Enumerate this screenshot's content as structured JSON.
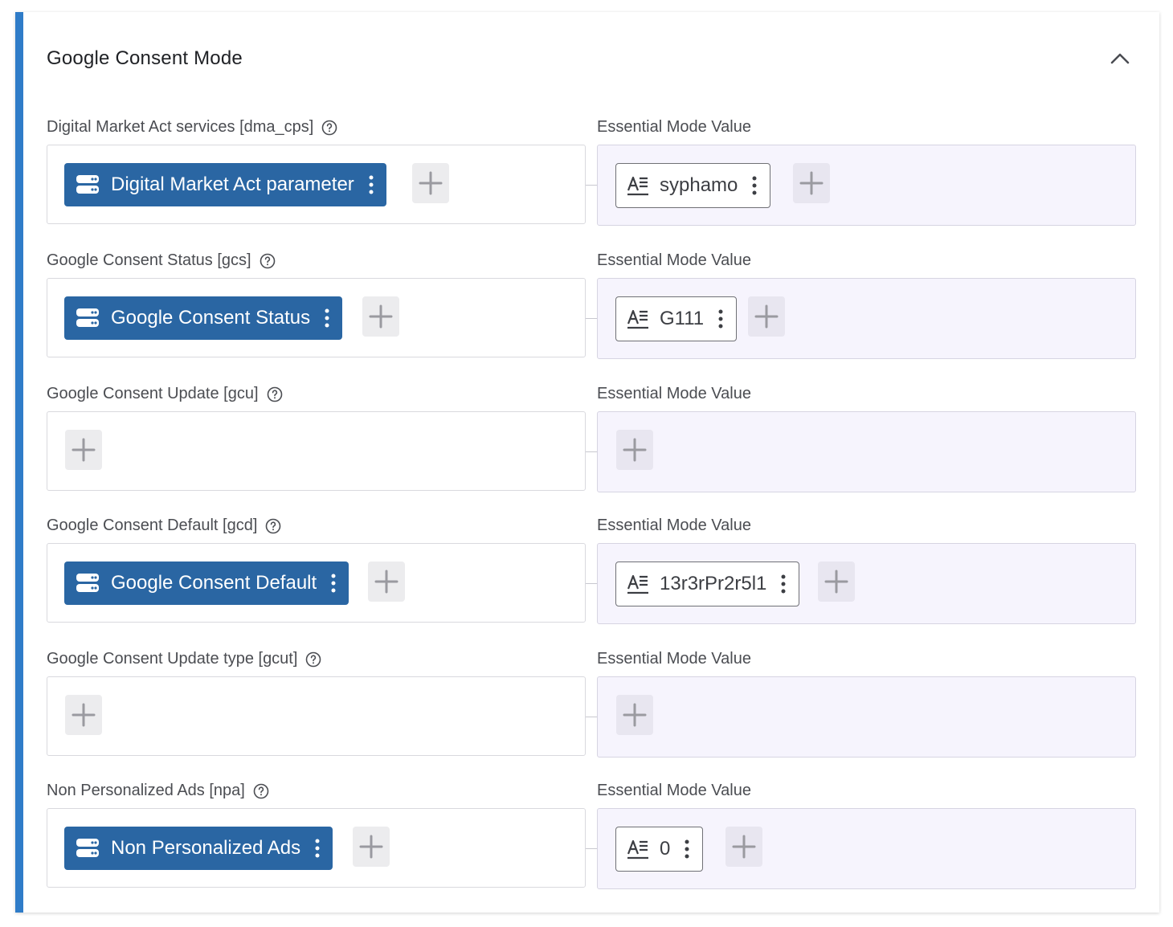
{
  "section": {
    "title": "Google Consent Mode"
  },
  "rows": [
    {
      "label": "Digital Market Act services [dma_cps]",
      "variable": "Digital Market Act parameter",
      "essential_label": "Essential Mode Value",
      "essential_value": "syphamo"
    },
    {
      "label": "Google Consent Status [gcs]",
      "variable": "Google Consent Status",
      "essential_label": "Essential Mode Value",
      "essential_value": "G111"
    },
    {
      "label": "Google Consent Update [gcu]",
      "variable": "",
      "essential_label": "Essential Mode Value",
      "essential_value": ""
    },
    {
      "label": "Google Consent Default [gcd]",
      "variable": "Google Consent Default",
      "essential_label": "Essential Mode Value",
      "essential_value": "13r3rPr2r5l1"
    },
    {
      "label": "Google Consent Update type [gcut]",
      "variable": "",
      "essential_label": "Essential Mode Value",
      "essential_value": ""
    },
    {
      "label": "Non Personalized Ads [npa]",
      "variable": "Non Personalized Ads",
      "essential_label": "Essential Mode Value",
      "essential_value": "0"
    }
  ],
  "icons": {
    "collapse": "chevron-up-icon",
    "help": "question-circle-icon",
    "variable": "database-icon",
    "text_value": "text-format-icon",
    "more": "kebab-menu-icon",
    "add": "plus-icon"
  },
  "colors": {
    "accent": "#2f7cc8",
    "variable_chip": "#2a66a3",
    "essential_bg": "#f6f4fd"
  }
}
